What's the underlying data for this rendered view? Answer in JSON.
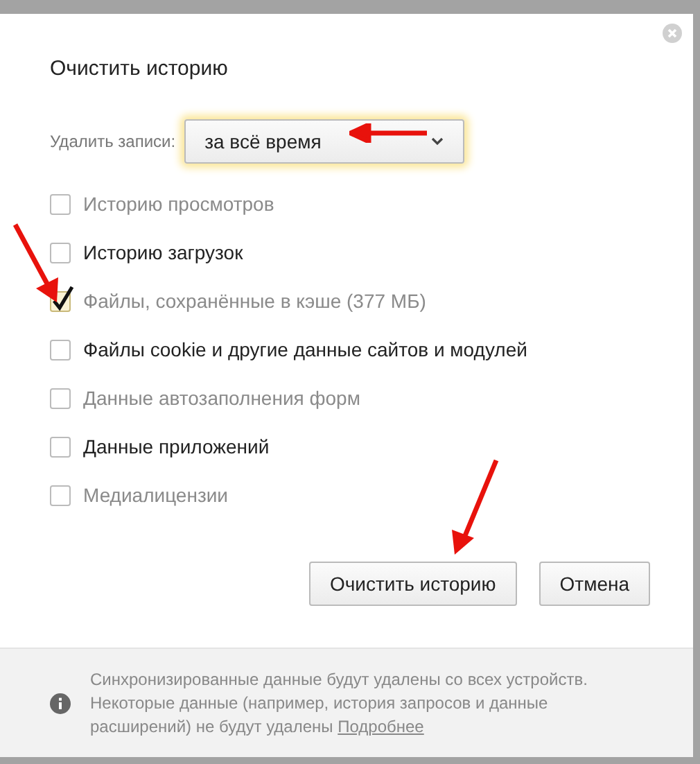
{
  "dialog": {
    "title": "Очистить историю",
    "range": {
      "label": "Удалить записи:",
      "value": "за всё время"
    },
    "options": [
      {
        "label": "Историю просмотров",
        "checked": false,
        "dimmed": true
      },
      {
        "label": "Историю загрузок",
        "checked": false,
        "dimmed": false
      },
      {
        "label": "Файлы, сохранённые в кэше (377 МБ)",
        "checked": true,
        "dimmed": true
      },
      {
        "label": "Файлы cookie и другие данные сайтов и модулей",
        "checked": false,
        "dimmed": false
      },
      {
        "label": "Данные автозаполнения форм",
        "checked": false,
        "dimmed": true
      },
      {
        "label": "Данные приложений",
        "checked": false,
        "dimmed": false
      },
      {
        "label": "Медиалицензии",
        "checked": false,
        "dimmed": true
      }
    ],
    "buttons": [
      "Очистить историю",
      "Отмена"
    ],
    "footer": {
      "text": "Синхронизированные данные будут удалены со всех устройств. Некоторые данные (например, история запросов и данные расширений) не будут удалены",
      "link": "Подробнее"
    }
  }
}
